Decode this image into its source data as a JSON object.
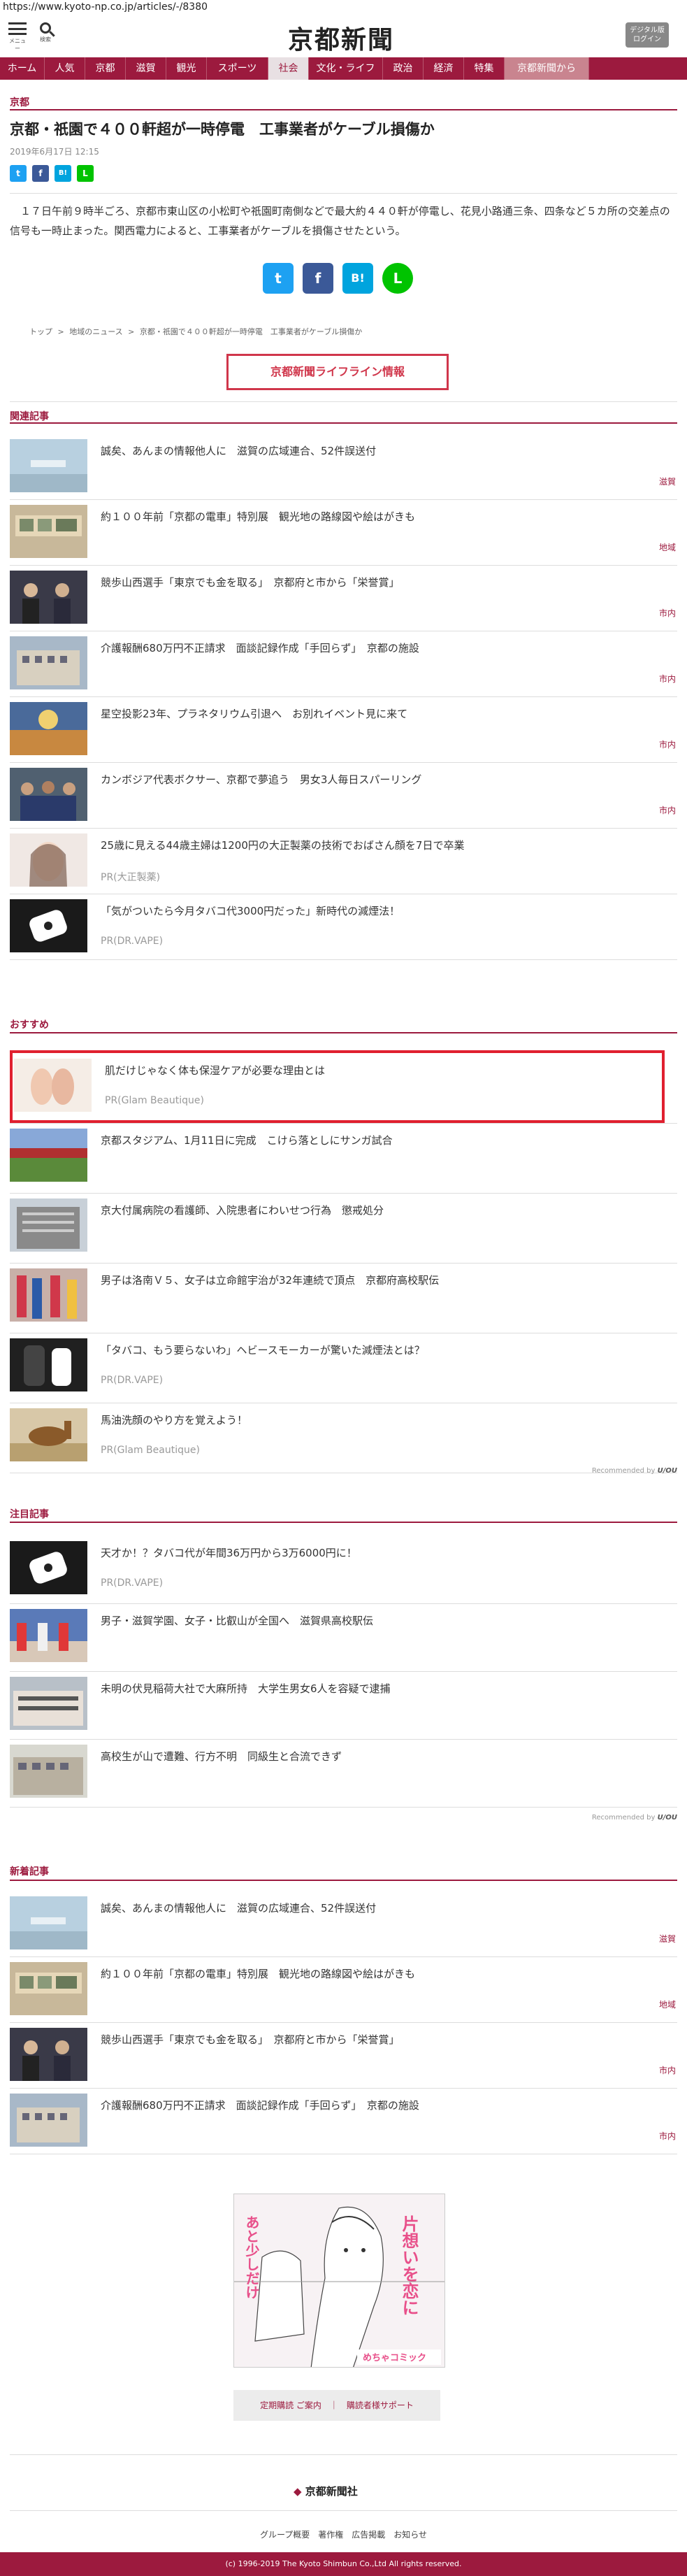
{
  "url": "https://www.kyoto-np.co.jp/articles/-/8380",
  "header": {
    "menu_label": "メニュー",
    "search_label": "検索",
    "logo": "京都新聞",
    "login_label": "デジタル版\nログイン"
  },
  "nav": [
    {
      "label": "ホーム",
      "active": false
    },
    {
      "label": "人気",
      "active": false
    },
    {
      "label": "京都",
      "active": false
    },
    {
      "label": "滋賀",
      "active": false
    },
    {
      "label": "観光",
      "active": false
    },
    {
      "label": "スポーツ",
      "active": false
    },
    {
      "label": "社会",
      "active": true
    },
    {
      "label": "文化・ライフ",
      "active": false
    },
    {
      "label": "政治",
      "active": false
    },
    {
      "label": "経済",
      "active": false
    },
    {
      "label": "特集",
      "active": false
    },
    {
      "label": "京都新聞から",
      "active": false
    }
  ],
  "article": {
    "section": "京都",
    "title": "京都・祇園で４００軒超が一時停電　工事業者がケーブル損傷か",
    "date": "2019年6月17日 12:15",
    "body": "１７日午前９時半ごろ、京都市東山区の小松町や祇園町南側などで最大約４４０軒が停電し、花見小路通三条、四条など５カ所の交差点の信号も一時止まった。関西電力によると、工事業者がケーブルを損傷させたという。",
    "breadcrumbs": [
      "トップ",
      "地域のニュース",
      "京都・祇園で４００軒超が一時停電　工事業者がケーブル損傷か"
    ],
    "lifeline_button": "京都新聞ライフライン情報"
  },
  "share": [
    "Twitter",
    "Facebook",
    "はてな",
    "LINE"
  ],
  "share_glyphs": [
    "t",
    "f",
    "B!",
    "L"
  ],
  "related": {
    "heading": "関連記事",
    "items": [
      {
        "title": "誠矣、あんまの情報他人に　滋賀の広域連合、52件誤送付",
        "tag": "滋賀",
        "pr": ""
      },
      {
        "title": "約１００年前「京都の電車」特別展　観光地の路線図や絵はがきも",
        "tag": "地域",
        "pr": ""
      },
      {
        "title": "競歩山西選手「東京でも金を取る」　京都府と市から「栄誉賞」",
        "tag": "市内",
        "pr": ""
      },
      {
        "title": "介護報酬680万円不正請求　面談記録作成「手回らず」　京都の施設",
        "tag": "市内",
        "pr": ""
      },
      {
        "title": "星空投影23年、プラネタリウム引退へ　お別れイベント見に来て",
        "tag": "市内",
        "pr": ""
      },
      {
        "title": "カンボジア代表ボクサー、京都で夢追う　男女3人毎日スパーリング",
        "tag": "市内",
        "pr": ""
      },
      {
        "title": "25歳に見える44歳主婦は1200円の大正製薬の技術でおばさん顔を7日で卒業",
        "tag": "",
        "pr": "PR(大正製薬)"
      },
      {
        "title": "「気がついたら今月タバコ代3000円だった」新時代の減煙法！",
        "tag": "",
        "pr": "PR(DR.VAPE)"
      }
    ]
  },
  "recommended": {
    "heading": "おすすめ",
    "items": [
      {
        "title": "肌だけじゃなく体も保湿ケアが必要な理由とは",
        "pr": "PR(Glam Beautique)"
      },
      {
        "title": "京都スタジアム、1月11日に完成　こけら落としにサンガ試合",
        "pr": ""
      },
      {
        "title": "京大付属病院の看護師、入院患者にわいせつ行為　懲戒処分",
        "pr": ""
      },
      {
        "title": "男子は洛南Ｖ５、女子は立命館宇治が32年連続で頂点　京都府高校駅伝",
        "pr": ""
      },
      {
        "title": "「タバコ、もう要らないわ」ヘビースモーカーが驚いた減煙法とは？",
        "pr": "PR(DR.VAPE)"
      },
      {
        "title": "馬油洗顔のやり方を覚えよう！",
        "pr": "PR(Glam Beautique)"
      }
    ],
    "recommended_by": "Recommended by",
    "brand": "U/OU"
  },
  "attention": {
    "heading": "注目記事",
    "items": [
      {
        "title": "天才か！？タバコ代が年間36万円から3万6000円に！",
        "pr": "PR(DR.VAPE)"
      },
      {
        "title": "男子・滋賀学園、女子・比叡山が全国へ　滋賀県高校駅伝",
        "pr": ""
      },
      {
        "title": "未明の伏見稲荷大社で大麻所持　大学生男女6人を容疑で逮捕",
        "pr": ""
      },
      {
        "title": "高校生が山で遭難、行方不明　同級生と合流できず",
        "pr": ""
      }
    ],
    "recommended_by": "Recommended by",
    "brand": "U/OU"
  },
  "latest": {
    "heading": "新着記事",
    "items": [
      {
        "title": "誠矣、あんまの情報他人に　滋賀の広域連合、52件誤送付",
        "tag": "滋賀"
      },
      {
        "title": "約１００年前「京都の電車」特別展　観光地の路線図や絵はがきも",
        "tag": "地域"
      },
      {
        "title": "競歩山西選手「東京でも金を取る」　京都府と市から「栄誉賞」",
        "tag": "市内"
      },
      {
        "title": "介護報酬680万円不正請求　面談記録作成「手回らず」　京都の施設",
        "tag": "市内"
      }
    ]
  },
  "ad": {
    "label": "めちゃコミック",
    "text_a": "片想いを恋に",
    "text_b": "あと少しだけ"
  },
  "ad_buttons": "定期購読 ご案内　｜　購読者様サポート",
  "footer": {
    "logo": "京都新聞社",
    "links": "グループ概要　著作権　広告掲載　お知らせ",
    "copyright": "(c) 1996-2019 The Kyoto Shimbun Co.,Ltd All rights reserved."
  },
  "colors": {
    "brand": "#9c1a3e",
    "twitter": "#1da1f2",
    "facebook": "#3b5998",
    "hatena": "#00a4de",
    "line": "#00c300",
    "highlight": "#e0202f"
  }
}
